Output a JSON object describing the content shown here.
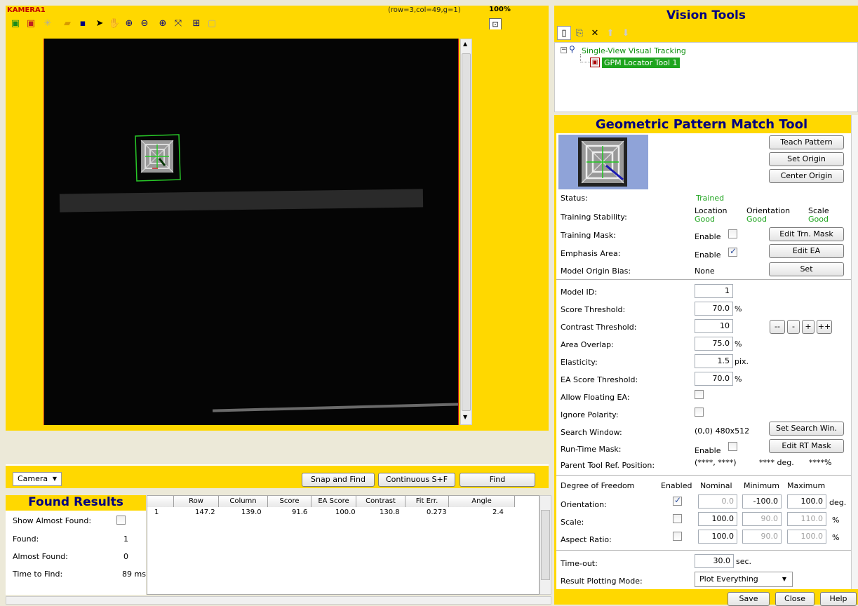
{
  "camera": {
    "title": "KAMERA1",
    "coords": "(row=3,col=49,g=1)",
    "zoom": "100%"
  },
  "camera_toolbar": [
    "camera-green-icon",
    "camera-red-icon",
    "flash-icon",
    "open-folder-icon",
    "save-icon",
    "pointer-icon",
    "hand-icon",
    "zoom-in-icon",
    "zoom-out-icon",
    "zoom-fit-icon",
    "zoom-box-icon",
    "grid-icon",
    "frame-icon"
  ],
  "bottom_bar": {
    "camera_select": "Camera",
    "snap_find": "Snap and Find",
    "continuous": "Continuous S+F",
    "find": "Find"
  },
  "found_results": {
    "title": "Found Results",
    "show_almost_label": "Show Almost Found:",
    "found_label": "Found:",
    "found_value": "1",
    "almost_label": "Almost Found:",
    "almost_value": "0",
    "time_label": "Time to Find:",
    "time_value": "89 ms."
  },
  "results_table": {
    "columns": [
      "Row",
      "Column",
      "Score",
      "EA Score",
      "Contrast",
      "Fit Err.",
      "Angle"
    ],
    "rows": [
      {
        "index": "1",
        "cells": [
          "147.2",
          "139.0",
          "91.6",
          "100.0",
          "130.8",
          "0.273",
          "2.4"
        ]
      }
    ]
  },
  "vision_tools": {
    "title": "Vision Tools",
    "tree_root": "Single-View Visual Tracking",
    "tree_child": "GPM Locator Tool 1"
  },
  "gpm": {
    "title": "Geometric Pattern Match Tool",
    "teach": "Teach Pattern",
    "set_origin": "Set Origin",
    "center_origin": "Center Origin",
    "status_label": "Status:",
    "status_value": "Trained",
    "stability_label": "Training Stability:",
    "loc_label": "Location",
    "loc_value": "Good",
    "orient_label": "Orientation",
    "orient_value": "Good",
    "scale_label": "Scale",
    "scale_value": "Good",
    "mask_label": "Training Mask:",
    "mask_enable": "Enable",
    "mask_button": "Edit Trn. Mask",
    "emphasis_label": "Emphasis Area:",
    "emphasis_enable": "Enable",
    "emphasis_button": "Edit EA",
    "bias_label": "Model Origin Bias:",
    "bias_value": "None",
    "bias_button": "Set",
    "model_id_label": "Model ID:",
    "model_id": "1",
    "score_label": "Score Threshold:",
    "score": "70.0",
    "score_unit": "%",
    "contrast_label": "Contrast Threshold:",
    "contrast": "10",
    "btn_mm": "--",
    "btn_m": "-",
    "btn_p": "+",
    "btn_pp": "++",
    "overlap_label": "Area Overlap:",
    "overlap": "75.0",
    "overlap_unit": "%",
    "elastic_label": "Elasticity:",
    "elastic": "1.5",
    "elastic_unit": "pix.",
    "ea_score_label": "EA Score Threshold:",
    "ea_score": "70.0",
    "ea_score_unit": "%",
    "floating_label": "Allow Floating EA:",
    "polarity_label": "Ignore Polarity:",
    "search_label": "Search Window:",
    "search_value": "(0,0) 480x512",
    "search_button": "Set Search Win.",
    "rt_mask_label": "Run-Time Mask:",
    "rt_enable": "Enable",
    "rt_button": "Edit RT Mask",
    "parent_label": "Parent Tool Ref. Position:",
    "parent_pos": "(****, ****)",
    "parent_deg": "**** deg.",
    "parent_pct": "****%",
    "dof_label": "Degree of Freedom",
    "enabled_h": "Enabled",
    "nominal_h": "Nominal",
    "minimum_h": "Minimum",
    "maximum_h": "Maximum",
    "orient_row": "Orientation:",
    "orient_nom": "0.0",
    "orient_min": "-100.0",
    "orient_max": "100.0",
    "orient_unit": "deg.",
    "scale_row": "Scale:",
    "scale_nom": "100.0",
    "scale_min": "90.0",
    "scale_max": "110.0",
    "scale_unit": "%",
    "aspect_row": "Aspect Ratio:",
    "aspect_nom": "100.0",
    "aspect_min": "90.0",
    "aspect_max": "100.0",
    "aspect_unit": "%",
    "timeout_label": "Time-out:",
    "timeout": "30.0",
    "timeout_unit": "sec.",
    "plot_label": "Result Plotting Mode:",
    "plot_value": "Plot Everything"
  },
  "footer": {
    "save": "Save",
    "close": "Close",
    "help": "Help"
  }
}
